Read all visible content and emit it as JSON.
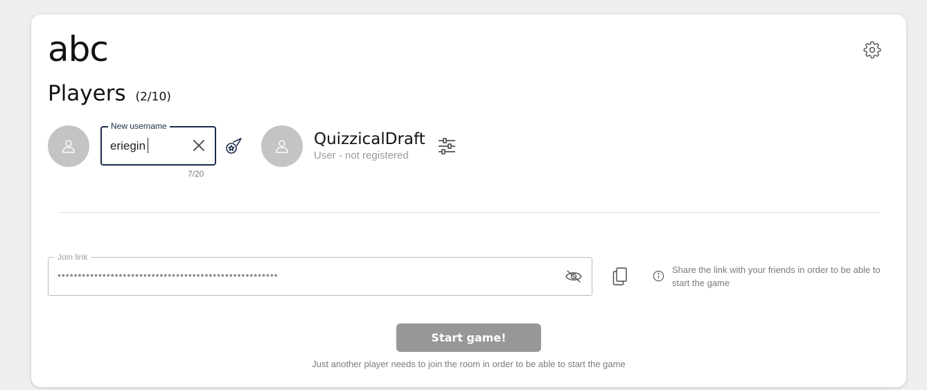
{
  "room": {
    "title": "abc"
  },
  "players_section": {
    "heading": "Players",
    "count": "(2/10)"
  },
  "username_editor": {
    "label": "New username",
    "value": "eriegin",
    "counter": "7/20"
  },
  "players": [
    {
      "name": "QuizzicalDraft",
      "status": "User - not registered"
    }
  ],
  "join_link": {
    "label": "Join link",
    "masked_value": "••••••••••••••••••••••••••••••••••••••••••••••••••••••"
  },
  "share_hint": "Share the link with your friends in order to be able to start the game",
  "start_button": {
    "label": "Start game!",
    "hint": "Just another player needs to join the room in order to be able to start the game",
    "disabled_color": "#979797"
  },
  "colors": {
    "accent": "#1a2a4a",
    "background": "#eeeeee",
    "avatar": "#c4c4c4"
  },
  "icons": {
    "settings": "gear-icon",
    "avatar": "user-icon",
    "clear": "close-icon",
    "random_name": "meteor-icon",
    "player_settings": "sliders-icon",
    "visibility": "eye-off-icon",
    "copy": "copy-icon",
    "info": "info-icon"
  }
}
